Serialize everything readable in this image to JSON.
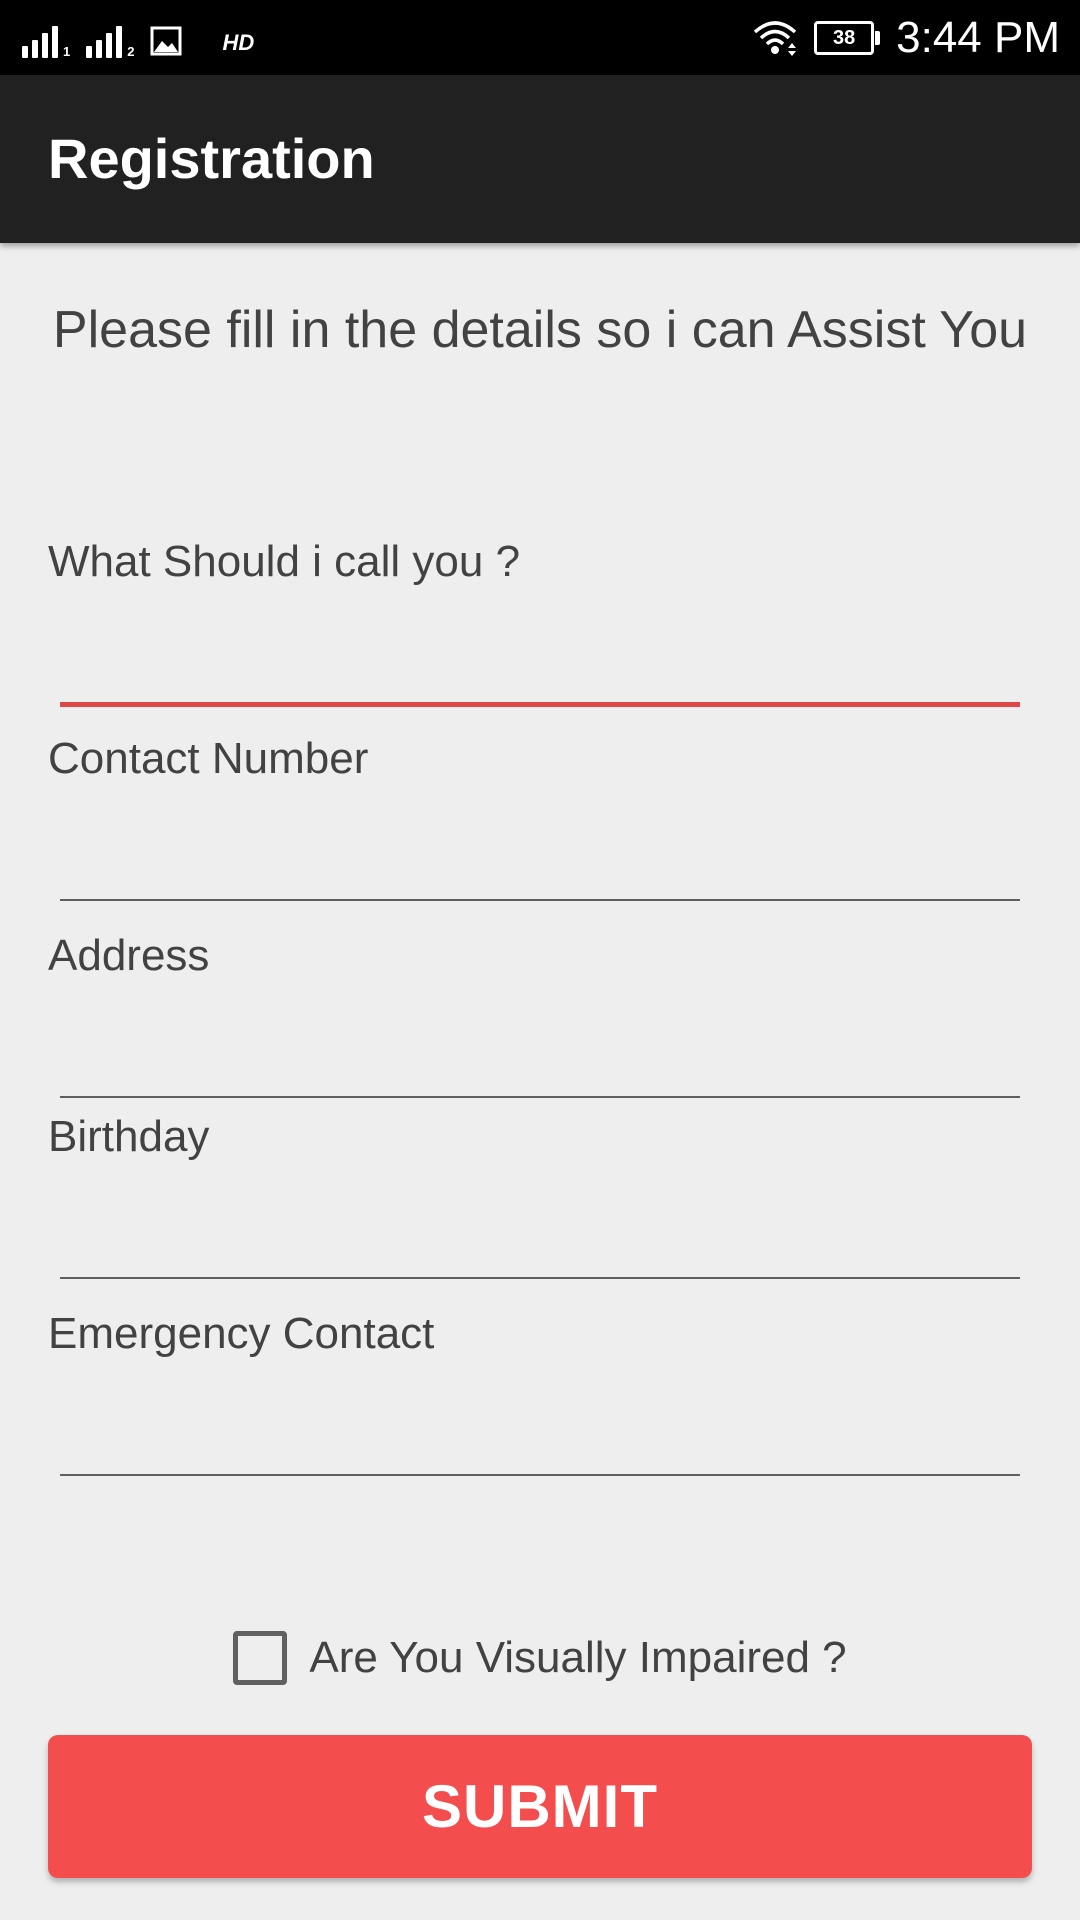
{
  "status_bar": {
    "time": "3:44 PM",
    "battery": "38",
    "network_label": "HD",
    "sim1_sub": "1",
    "sim2_sub": "2",
    "icons": [
      "signal-icon",
      "signal-icon",
      "image-icon",
      "wifi-icon",
      "battery-icon"
    ]
  },
  "app_bar": {
    "title": "Registration"
  },
  "intro": {
    "text": "Please fill in the details so i can Assist You"
  },
  "form": {
    "fields": [
      {
        "label": "What Should i call you ?",
        "value": "",
        "focused": true
      },
      {
        "label": "Contact Number",
        "value": "",
        "focused": false
      },
      {
        "label": "Address",
        "value": "",
        "focused": false
      },
      {
        "label": "Birthday",
        "value": "",
        "focused": false
      },
      {
        "label": "Emergency Contact",
        "value": "",
        "focused": false
      }
    ],
    "checkbox": {
      "label": "Are You Visually Impaired ?",
      "checked": false
    },
    "submit_label": "SUBMIT"
  },
  "colors": {
    "accent": "#f44d4d",
    "focus_underline": "#e04848",
    "app_bar": "#212121",
    "background": "#eeeeee"
  }
}
